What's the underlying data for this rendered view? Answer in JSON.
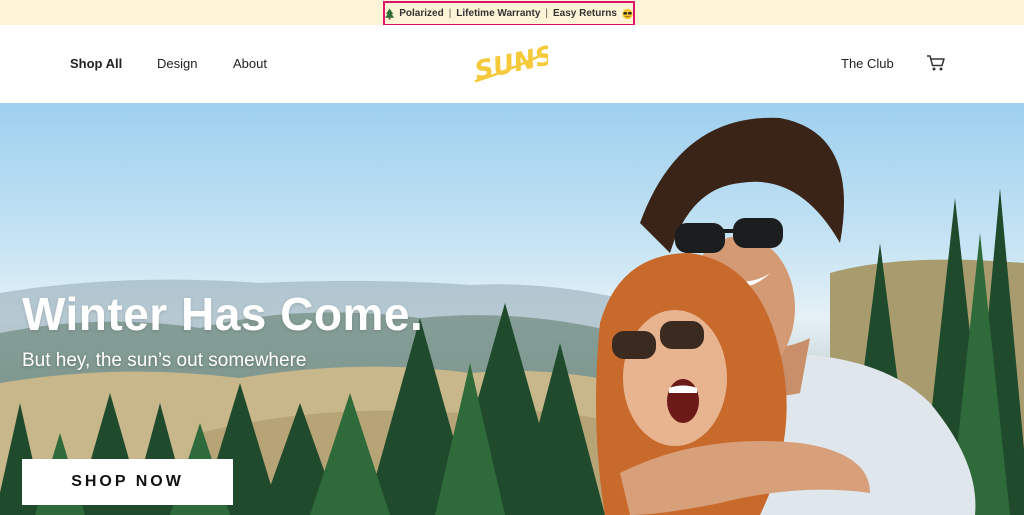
{
  "announcement": {
    "items": [
      "Polarized",
      "Lifetime Warranty",
      "Easy Returns"
    ],
    "separator": "|",
    "left_icon": "tree-icon",
    "right_icon": "sunglasses-emoji-icon",
    "highlight_color": "#e0116a",
    "background": "#fdf3d6"
  },
  "nav": {
    "left_links": [
      {
        "label": "Shop All",
        "active": true
      },
      {
        "label": "Design",
        "active": false
      },
      {
        "label": "About",
        "active": false
      }
    ],
    "logo_text": "SUNSKI",
    "right_link": "The Club",
    "cart_icon": "cart-icon",
    "accent_color": "#f5c93a"
  },
  "hero": {
    "title": "Winter Has Come.",
    "subtitle": "But hey, the sun’s out somewhere",
    "cta_label": "SHOP NOW",
    "image": "couple-wearing-sunglasses-photo"
  }
}
